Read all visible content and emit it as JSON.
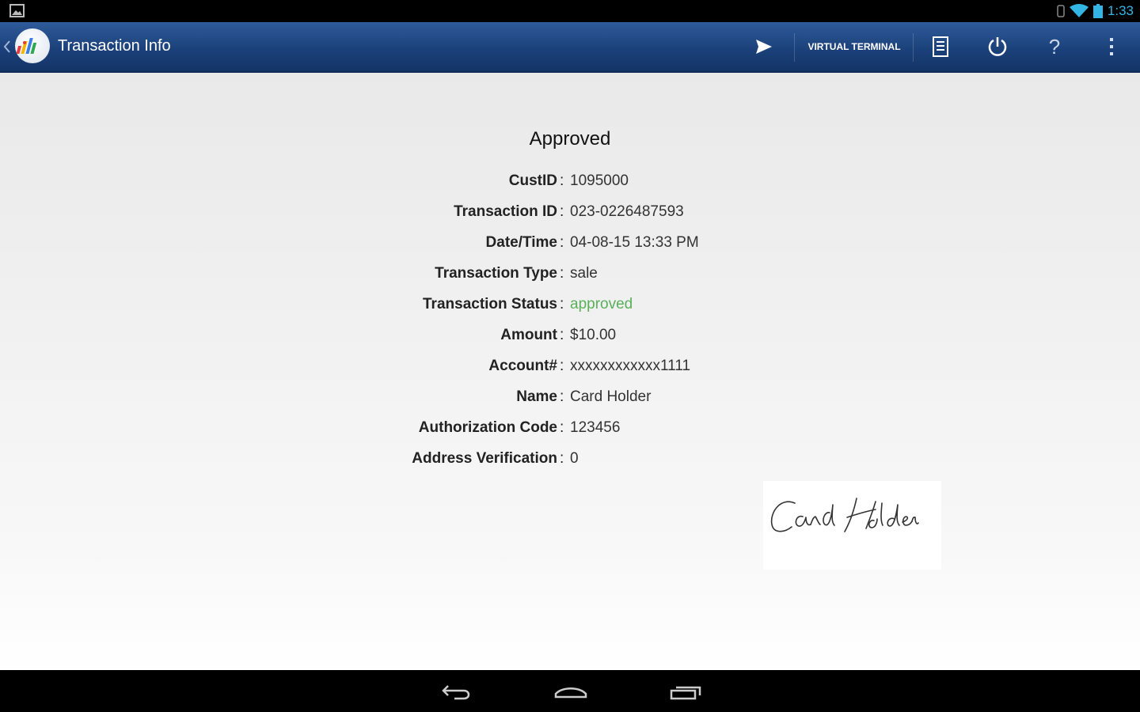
{
  "status_bar": {
    "time": "1:33",
    "icons": [
      "picture-notification-icon",
      "bluetooth-icon",
      "wifi-icon",
      "battery-icon"
    ]
  },
  "action_bar": {
    "title": "Transaction Info",
    "virtual_terminal_label": "VIRTUAL TERMINAL",
    "actions": [
      "send-icon",
      "virtual-terminal-button",
      "receipt-icon",
      "power-icon",
      "help-icon",
      "overflow-menu-icon"
    ],
    "help_glyph": "?"
  },
  "transaction": {
    "title": "Approved",
    "rows": [
      {
        "label": "CustID",
        "value": "1095000"
      },
      {
        "label": "Transaction ID",
        "value": "023-0226487593"
      },
      {
        "label": "Date/Time",
        "value": "04-08-15 13:33 PM"
      },
      {
        "label": "Transaction Type",
        "value": "sale"
      },
      {
        "label": "Transaction Status",
        "value": "approved"
      },
      {
        "label": "Amount",
        "value": "$10.00"
      },
      {
        "label": "Account#",
        "value": "xxxxxxxxxxxx1111"
      },
      {
        "label": "Name",
        "value": "Card Holder"
      },
      {
        "label": "Authorization Code",
        "value": "123456"
      },
      {
        "label": "Address Verification",
        "value": "0"
      }
    ],
    "separator": ":",
    "signature": "Card Holder"
  },
  "colors": {
    "action_bar": "#1a3f78",
    "status_accent": "#33b5e5",
    "approved": "#5ab05a"
  },
  "nav_bar": {
    "buttons": [
      "back-icon",
      "home-icon",
      "recent-apps-icon"
    ]
  }
}
